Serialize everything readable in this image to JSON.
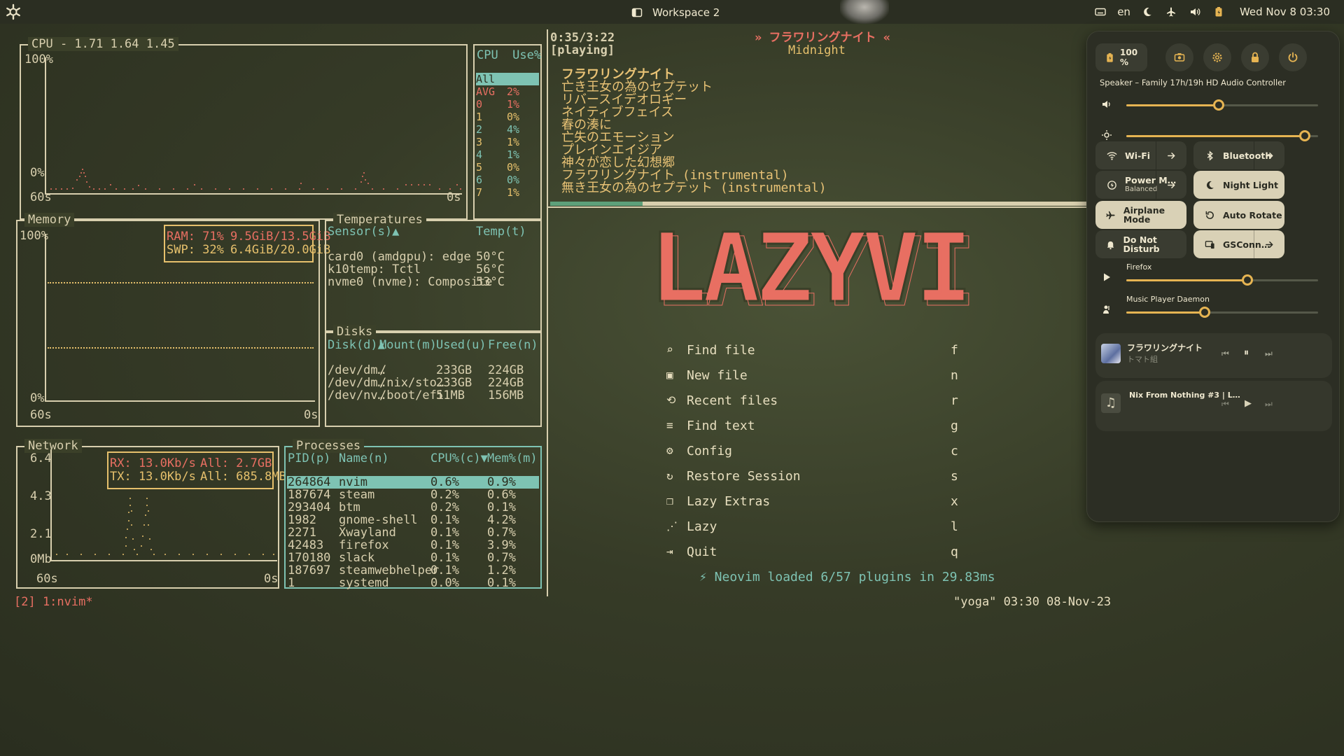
{
  "topbar": {
    "workspace": "Workspace 2",
    "lang": "en",
    "clock": "Wed Nov 8  03:30"
  },
  "cpu": {
    "title": "CPU - 1.71 1.64 1.45",
    "y_max": "100%",
    "y_min": "0%",
    "x_left": "60s",
    "x_right": "0s",
    "table_header": "CPU  Use%",
    "rows": [
      {
        "cpu": "All",
        "use": ""
      },
      {
        "cpu": "AVG",
        "use": "2%"
      },
      {
        "cpu": "0",
        "use": "1%"
      },
      {
        "cpu": "1",
        "use": "0%"
      },
      {
        "cpu": "2",
        "use": "4%"
      },
      {
        "cpu": "3",
        "use": "1%"
      },
      {
        "cpu": "4",
        "use": "1%"
      },
      {
        "cpu": "5",
        "use": "0%"
      },
      {
        "cpu": "6",
        "use": "0%"
      },
      {
        "cpu": "7",
        "use": "1%"
      }
    ]
  },
  "memory": {
    "title": "Memory",
    "y_max": "100%",
    "y_min": "0%",
    "x_left": "60s",
    "x_right": "0s",
    "ram_label": "RAM: 71%",
    "ram_value": "9.5GiB/13.5GiB",
    "swp_label": "SWP: 32%",
    "swp_value": "6.4GiB/20.0GiB",
    "ram_percent": 71,
    "swp_percent": 32
  },
  "temperatures": {
    "title": "Temperatures",
    "header_sensor": "Sensor(s)▲",
    "header_temp": "Temp(t)",
    "rows": [
      {
        "sensor": "card0 (amdgpu): edge",
        "temp": "50°C"
      },
      {
        "sensor": "k10temp: Tctl",
        "temp": "56°C"
      },
      {
        "sensor": "nvme0 (nvme): Composite",
        "temp": "53°C"
      }
    ]
  },
  "disks": {
    "title": "Disks",
    "headers": [
      "Disk(d)▲",
      "Mount(m)",
      "Used(u)",
      "Free(n)"
    ],
    "rows": [
      [
        "/dev/dm…",
        "/",
        "233GB",
        "224GB"
      ],
      [
        "/dev/dm…",
        "/nix/sto…",
        "233GB",
        "224GB"
      ],
      [
        "/dev/nv…",
        "/boot/efi",
        "51MB",
        "156MB"
      ]
    ]
  },
  "network": {
    "title": "Network",
    "y_ticks": [
      "6.4",
      "4.3",
      "2.1",
      "0Mb"
    ],
    "x_left": "60s",
    "x_right": "0s",
    "rx": "RX: 13.0Kb/s",
    "rx_all": "All: 2.7GB",
    "tx": "TX: 13.0Kb/s",
    "tx_all": "All: 685.8MB"
  },
  "processes": {
    "title": "Processes",
    "headers": [
      "PID(p)",
      "Name(n)",
      "CPU%(c)▼",
      "Mem%(m)"
    ],
    "rows": [
      [
        "264864",
        "nvim",
        "0.6%",
        "0.9%"
      ],
      [
        "187674",
        "steam",
        "0.2%",
        "0.6%"
      ],
      [
        "293404",
        "btm",
        "0.2%",
        "0.1%"
      ],
      [
        "1982",
        "gnome-shell",
        "0.1%",
        "4.2%"
      ],
      [
        "2271",
        "Xwayland",
        "0.1%",
        "0.7%"
      ],
      [
        "42483",
        "firefox",
        "0.1%",
        "3.9%"
      ],
      [
        "170180",
        "slack",
        "0.1%",
        "0.7%"
      ],
      [
        "187697",
        "steamwebhelper",
        "0.1%",
        "1.2%"
      ],
      [
        "1",
        "systemd",
        "0.0%",
        "0.1%"
      ]
    ]
  },
  "music": {
    "time": "0:35/3:22",
    "state": "[playing]",
    "now_title": "» フラワリングナイト «",
    "album": "Midnight",
    "progress": 0.17,
    "playlist": [
      "フラワリングナイト",
      "亡き王女の為のセプテット",
      "リバースイデオロギー",
      "ネイティブフェイス",
      "春の湊に",
      "亡失のエモーション",
      "プレインエイジア",
      "神々が恋した幻想郷",
      "フラワリングナイト (instrumental)",
      "無き王女の為のセプテット (instrumental)"
    ]
  },
  "lazyvim": {
    "logo": "LAZYVI",
    "menu": [
      {
        "label": "Find file",
        "key": "f"
      },
      {
        "label": "New file",
        "key": "n"
      },
      {
        "label": "Recent files",
        "key": "r"
      },
      {
        "label": "Find text",
        "key": "g"
      },
      {
        "label": "Config",
        "key": "c"
      },
      {
        "label": "Restore Session",
        "key": "s"
      },
      {
        "label": "Lazy Extras",
        "key": "x"
      },
      {
        "label": "Lazy",
        "key": "l"
      },
      {
        "label": "Quit",
        "key": "q"
      }
    ],
    "footer": "⚡ Neovim loaded 6/57 plugins in 29.83ms"
  },
  "statusline": {
    "left": "[2] 1:nvim*",
    "right": "\"yoga\" 03:30 08-Nov-23"
  },
  "quick_settings": {
    "battery": "100 %",
    "output_device": "Speaker – Family 17h/19h HD Audio Controller",
    "volume_level": 0.48,
    "brightness_level": 0.93,
    "tiles": [
      {
        "label": "Wi-Fi",
        "sub": "",
        "on": false,
        "arrow": true,
        "icon": "wifi-icon"
      },
      {
        "label": "Bluetooth",
        "sub": "",
        "on": false,
        "arrow": true,
        "icon": "bluetooth-icon"
      },
      {
        "label": "Power M…",
        "sub": "Balanced",
        "on": false,
        "arrow": true,
        "icon": "power-mode-icon"
      },
      {
        "label": "Night Light",
        "sub": "",
        "on": true,
        "arrow": false,
        "icon": "moon-icon"
      },
      {
        "label": "Airplane Mode",
        "sub": "",
        "on": true,
        "arrow": false,
        "icon": "airplane-icon"
      },
      {
        "label": "Auto Rotate",
        "sub": "",
        "on": true,
        "arrow": false,
        "icon": "rotate-icon"
      },
      {
        "label": "Do Not Disturb",
        "sub": "",
        "on": false,
        "arrow": false,
        "icon": "bell-icon"
      },
      {
        "label": "GSConn…",
        "sub": "",
        "on": true,
        "arrow": true,
        "icon": "device-icon"
      }
    ],
    "app_volumes": [
      {
        "name": "Firefox",
        "level": 0.63
      },
      {
        "name": "Music Player Daemon",
        "level": 0.41
      }
    ],
    "media": [
      {
        "title": "フラワリングナイト",
        "artist": "トマト組",
        "playing": true
      },
      {
        "title": "Nix From Nothing #3 | L…",
        "artist": "",
        "playing": false
      }
    ]
  },
  "colors": {
    "accent_teal": "#7ec3b3",
    "accent_yellow": "#e6c06c",
    "accent_red": "#e86f62",
    "slider_accent": "#e6b452"
  }
}
